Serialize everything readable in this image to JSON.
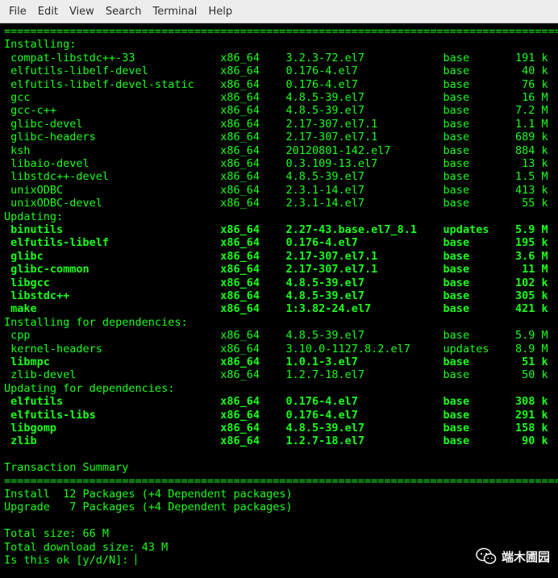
{
  "menu": {
    "items": [
      "File",
      "Edit",
      "View",
      "Search",
      "Terminal",
      "Help"
    ]
  },
  "terminal": {
    "lines": [
      {
        "text": "=========================================================================================",
        "bold": false
      },
      {
        "text": "Installing:",
        "bold": false
      },
      {
        "text": " compat-libstdc++-33             x86_64    3.2.3-72.el7            base       191 k",
        "bold": false
      },
      {
        "text": " elfutils-libelf-devel           x86_64    0.176-4.el7             base        40 k",
        "bold": false
      },
      {
        "text": " elfutils-libelf-devel-static    x86_64    0.176-4.el7             base        76 k",
        "bold": false
      },
      {
        "text": " gcc                             x86_64    4.8.5-39.el7            base        16 M",
        "bold": false
      },
      {
        "text": " gcc-c++                         x86_64    4.8.5-39.el7            base       7.2 M",
        "bold": false
      },
      {
        "text": " glibc-devel                     x86_64    2.17-307.el7.1          base       1.1 M",
        "bold": false
      },
      {
        "text": " glibc-headers                   x86_64    2.17-307.el7.1          base       689 k",
        "bold": false
      },
      {
        "text": " ksh                             x86_64    20120801-142.el7        base       884 k",
        "bold": false
      },
      {
        "text": " libaio-devel                    x86_64    0.3.109-13.el7          base        13 k",
        "bold": false
      },
      {
        "text": " libstdc++-devel                 x86_64    4.8.5-39.el7            base       1.5 M",
        "bold": false
      },
      {
        "text": " unixODBC                        x86_64    2.3.1-14.el7            base       413 k",
        "bold": false
      },
      {
        "text": " unixODBC-devel                  x86_64    2.3.1-14.el7            base        55 k",
        "bold": false
      },
      {
        "text": "Updating:",
        "bold": false
      },
      {
        "text": " binutils                        x86_64    2.27-43.base.el7_8.1    updates    5.9 M",
        "bold": true
      },
      {
        "text": " elfutils-libelf                 x86_64    0.176-4.el7             base       195 k",
        "bold": true
      },
      {
        "text": " glibc                           x86_64    2.17-307.el7.1          base       3.6 M",
        "bold": true
      },
      {
        "text": " glibc-common                    x86_64    2.17-307.el7.1          base        11 M",
        "bold": true
      },
      {
        "text": " libgcc                          x86_64    4.8.5-39.el7            base       102 k",
        "bold": true
      },
      {
        "text": " libstdc++                       x86_64    4.8.5-39.el7            base       305 k",
        "bold": true
      },
      {
        "text": " make                            x86_64    1:3.82-24.el7           base       421 k",
        "bold": true
      },
      {
        "text": "Installing for dependencies:",
        "bold": false
      },
      {
        "text": " cpp                             x86_64    4.8.5-39.el7            base       5.9 M",
        "bold": false
      },
      {
        "text": " kernel-headers                  x86_64    3.10.0-1127.8.2.el7     updates    8.9 M",
        "bold": false
      },
      {
        "text": " libmpc                          x86_64    1.0.1-3.el7             base        51 k",
        "bold": true
      },
      {
        "text": " zlib-devel                      x86_64    1.2.7-18.el7            base        50 k",
        "bold": false
      },
      {
        "text": "Updating for dependencies:",
        "bold": false
      },
      {
        "text": " elfutils                        x86_64    0.176-4.el7             base       308 k",
        "bold": true
      },
      {
        "text": " elfutils-libs                   x86_64    0.176-4.el7             base       291 k",
        "bold": true
      },
      {
        "text": " libgomp                         x86_64    4.8.5-39.el7            base       158 k",
        "bold": true
      },
      {
        "text": " zlib                            x86_64    1.2.7-18.el7            base        90 k",
        "bold": true
      },
      {
        "text": "",
        "bold": false
      },
      {
        "text": "Transaction Summary",
        "bold": false
      },
      {
        "text": "=========================================================================================",
        "bold": false
      },
      {
        "text": "Install  12 Packages (+4 Dependent packages)",
        "bold": false
      },
      {
        "text": "Upgrade   7 Packages (+4 Dependent packages)",
        "bold": false
      },
      {
        "text": "",
        "bold": false
      },
      {
        "text": "Total size: 66 M",
        "bold": false
      },
      {
        "text": "Total download size: 43 M",
        "bold": false
      },
      {
        "text": "Is this ok [y/d/N]: ",
        "bold": false
      }
    ]
  },
  "watermark": {
    "text": "端木圃园",
    "icon": "wechat-icon"
  },
  "colors": {
    "terminal_text": "#19ff19",
    "terminal_bg": "#000000",
    "menubar_bg": "#ededed"
  }
}
